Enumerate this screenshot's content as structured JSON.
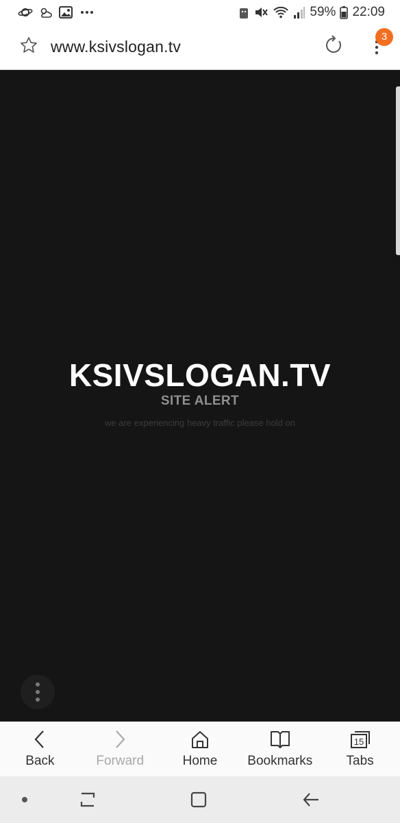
{
  "status_bar": {
    "battery": "59%",
    "time": "22:09"
  },
  "browser": {
    "url": "www.ksivslogan.tv",
    "menu_badge": "3"
  },
  "page": {
    "title": "KSIVSLOGAN.TV",
    "alert": "SITE ALERT",
    "message": "we are experiencing heavy traffic please hold on"
  },
  "toolbar": {
    "back": "Back",
    "forward": "Forward",
    "home": "Home",
    "bookmarks": "Bookmarks",
    "tabs": "Tabs",
    "tab_count": "15"
  }
}
